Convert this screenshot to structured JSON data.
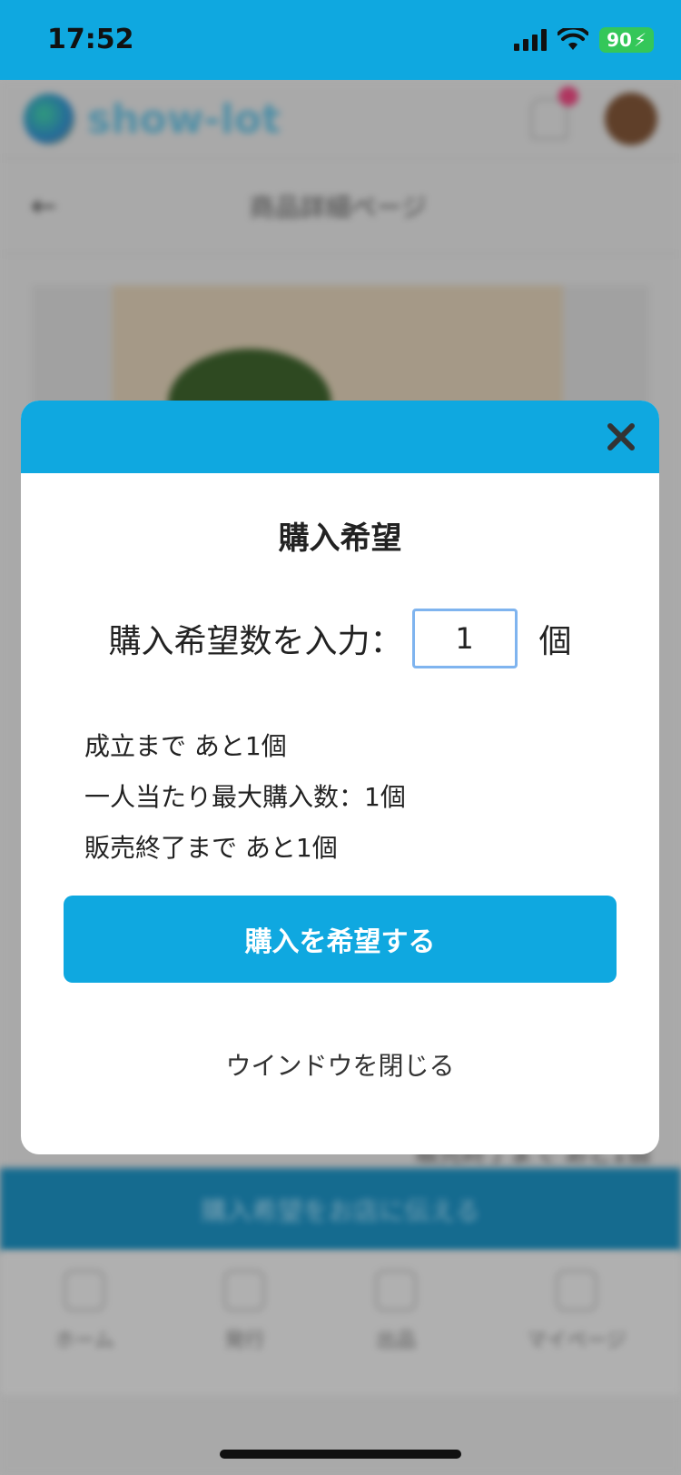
{
  "status_bar": {
    "time": "17:52",
    "battery": "90"
  },
  "background": {
    "logo_text": "show-lot",
    "page_title": "商品詳細ページ",
    "progress_text": "販売終了まで あと1個",
    "cta_label": "購入希望をお店に伝える",
    "tabs": [
      {
        "label": "ホーム",
        "icon": "home-icon"
      },
      {
        "label": "発行",
        "icon": "pencil-icon"
      },
      {
        "label": "出品",
        "icon": "bag-icon"
      },
      {
        "label": "マイページ",
        "icon": "person-icon"
      }
    ]
  },
  "modal": {
    "title": "購入希望",
    "quantity_label": "購入希望数を入力：",
    "quantity_value": "1",
    "unit": "個",
    "info_lines": [
      "成立まで あと1個",
      "一人当たり最大購入数：1個",
      "販売終了まで あと1個"
    ],
    "submit_label": "購入を希望する",
    "close_label": "ウインドウを閉じる",
    "close_icon": "close-icon"
  },
  "colors": {
    "accent": "#0fa8e0",
    "input_border": "#7fb4ef"
  }
}
